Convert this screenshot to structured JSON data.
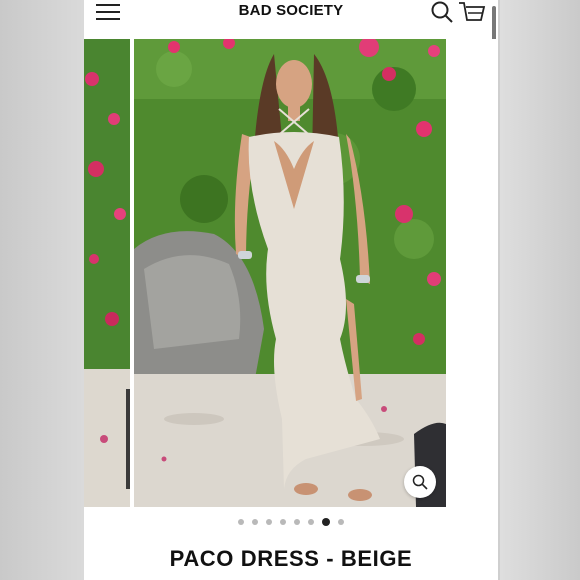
{
  "header": {
    "brand": "BAD SOCIETY",
    "menu_icon": "hamburger-menu-icon",
    "search_icon": "search-icon",
    "cart_icon": "shopping-cart-icon"
  },
  "gallery": {
    "active_index": 7,
    "total": 9,
    "zoom_icon": "zoom-icon",
    "colors": {
      "foliage": "#4f8a2e",
      "flowers": "#e2336e",
      "sand": "#dcd7cf",
      "dress": "#e6e0d6"
    }
  },
  "product": {
    "title": "PACO DRESS - BEIGE"
  }
}
